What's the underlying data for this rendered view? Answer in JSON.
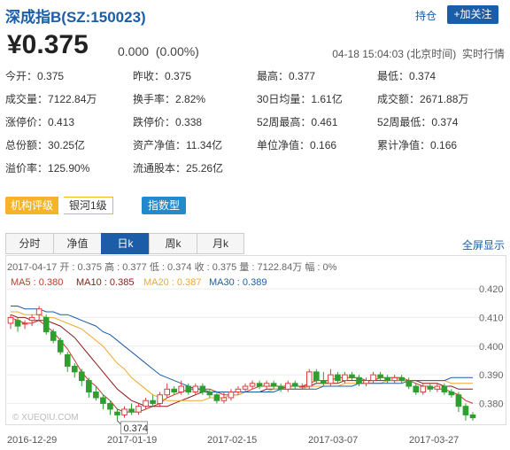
{
  "header": {
    "title": "深成指B(SZ:150023)",
    "hold_label": "持仓",
    "follow_label": "+加关注"
  },
  "quote": {
    "price": "¥0.375",
    "change": "0.000",
    "change_pct": "(0.00%)",
    "time": "04-18 15:04:03 (北京时间)",
    "status": "实时行情"
  },
  "stats": [
    [
      {
        "label": "今开",
        "value": "0.375"
      },
      {
        "label": "昨收",
        "value": "0.375"
      },
      {
        "label": "最高",
        "value": "0.377"
      },
      {
        "label": "最低",
        "value": "0.374"
      }
    ],
    [
      {
        "label": "成交量",
        "value": "7122.84万"
      },
      {
        "label": "换手率",
        "value": "2.82%"
      },
      {
        "label": "30日均量",
        "value": "1.61亿"
      },
      {
        "label": "成交额",
        "value": "2671.88万"
      }
    ],
    [
      {
        "label": "涨停价",
        "value": "0.413"
      },
      {
        "label": "跌停价",
        "value": "0.338"
      },
      {
        "label": "52周最高",
        "value": "0.461"
      },
      {
        "label": "52周最低",
        "value": "0.374"
      }
    ],
    [
      {
        "label": "总份额",
        "value": "30.25亿"
      },
      {
        "label": "资产净值",
        "value": "11.34亿"
      },
      {
        "label": "单位净值",
        "value": "0.166"
      },
      {
        "label": "累计净值",
        "value": "0.166"
      }
    ],
    [
      {
        "label": "溢价率",
        "value": "125.90%"
      },
      {
        "label": "流通股本",
        "value": "25.26亿"
      }
    ]
  ],
  "tags": {
    "rating_label": "机构评级",
    "rating_value": "银河1级",
    "index_label": "指数型"
  },
  "tabs": [
    "分时",
    "净值",
    "日k",
    "周k",
    "月k"
  ],
  "active_tab": "日k",
  "fullscreen_label": "全屏显示",
  "chart_info": "2017-04-17 开 : 0.375 高 : 0.377 低 : 0.374 收 : 0.375 量 : 7122.84万 幅 : 0%",
  "ma_labels": [
    {
      "text": "MA5 : 0.380",
      "color": "#c0392b"
    },
    {
      "text": "MA10 : 0.385",
      "color": "#8b1a1a"
    },
    {
      "text": "MA20 : 0.387",
      "color": "#f0a830"
    },
    {
      "text": "MA30 : 0.389",
      "color": "#1c5da8"
    }
  ],
  "watermark": "© XUEQIU.COM",
  "colors": {
    "up": "#e03c3c",
    "down": "#2e9e2e",
    "accent": "#1c5da8"
  },
  "chart_data": {
    "type": "candlestick",
    "y_ticks": [
      "0.420",
      "0.410",
      "0.400",
      "0.390",
      "0.380"
    ],
    "ylim": [
      0.3755,
      0.4225
    ],
    "x_labels": [
      "2016-12-29",
      "2017-01-19",
      "2017-02-15",
      "2017-03-07",
      "2017-03-27"
    ],
    "low_annotation": "0.374",
    "candles": [
      [
        0.408,
        0.41,
        0.406,
        0.411
      ],
      [
        0.409,
        0.407,
        0.405,
        0.41
      ],
      [
        0.408,
        0.408,
        0.406,
        0.409
      ],
      [
        0.409,
        0.41,
        0.407,
        0.411
      ],
      [
        0.411,
        0.413,
        0.409,
        0.414
      ],
      [
        0.41,
        0.405,
        0.404,
        0.411
      ],
      [
        0.405,
        0.402,
        0.401,
        0.406
      ],
      [
        0.402,
        0.398,
        0.397,
        0.403
      ],
      [
        0.397,
        0.393,
        0.391,
        0.398
      ],
      [
        0.393,
        0.391,
        0.389,
        0.394
      ],
      [
        0.391,
        0.388,
        0.386,
        0.392
      ],
      [
        0.388,
        0.384,
        0.382,
        0.389
      ],
      [
        0.384,
        0.382,
        0.381,
        0.386
      ],
      [
        0.382,
        0.38,
        0.378,
        0.383
      ],
      [
        0.38,
        0.378,
        0.376,
        0.381
      ],
      [
        0.377,
        0.376,
        0.374,
        0.378
      ],
      [
        0.376,
        0.378,
        0.375,
        0.379
      ],
      [
        0.378,
        0.377,
        0.376,
        0.38
      ],
      [
        0.377,
        0.379,
        0.376,
        0.38
      ],
      [
        0.379,
        0.381,
        0.378,
        0.382
      ],
      [
        0.381,
        0.38,
        0.379,
        0.383
      ],
      [
        0.38,
        0.383,
        0.379,
        0.384
      ],
      [
        0.383,
        0.385,
        0.382,
        0.387
      ],
      [
        0.385,
        0.384,
        0.383,
        0.386
      ],
      [
        0.384,
        0.386,
        0.383,
        0.388
      ],
      [
        0.386,
        0.384,
        0.383,
        0.387
      ],
      [
        0.384,
        0.386,
        0.383,
        0.387
      ],
      [
        0.386,
        0.384,
        0.383,
        0.387
      ],
      [
        0.384,
        0.383,
        0.382,
        0.385
      ],
      [
        0.383,
        0.381,
        0.38,
        0.384
      ],
      [
        0.381,
        0.382,
        0.38,
        0.384
      ],
      [
        0.382,
        0.384,
        0.381,
        0.385
      ],
      [
        0.384,
        0.385,
        0.383,
        0.386
      ],
      [
        0.385,
        0.386,
        0.384,
        0.387
      ],
      [
        0.386,
        0.387,
        0.385,
        0.388
      ],
      [
        0.387,
        0.386,
        0.385,
        0.388
      ],
      [
        0.386,
        0.387,
        0.385,
        0.388
      ],
      [
        0.387,
        0.386,
        0.385,
        0.388
      ],
      [
        0.386,
        0.385,
        0.384,
        0.387
      ],
      [
        0.385,
        0.387,
        0.384,
        0.388
      ],
      [
        0.387,
        0.386,
        0.385,
        0.388
      ],
      [
        0.386,
        0.386,
        0.385,
        0.387
      ],
      [
        0.386,
        0.391,
        0.385,
        0.392
      ],
      [
        0.391,
        0.388,
        0.387,
        0.392
      ],
      [
        0.388,
        0.387,
        0.386,
        0.391
      ],
      [
        0.387,
        0.39,
        0.386,
        0.392
      ],
      [
        0.39,
        0.388,
        0.387,
        0.391
      ],
      [
        0.388,
        0.39,
        0.387,
        0.391
      ],
      [
        0.39,
        0.389,
        0.388,
        0.391
      ],
      [
        0.389,
        0.387,
        0.386,
        0.39
      ],
      [
        0.387,
        0.388,
        0.386,
        0.389
      ],
      [
        0.388,
        0.39,
        0.387,
        0.391
      ],
      [
        0.39,
        0.389,
        0.388,
        0.391
      ],
      [
        0.389,
        0.388,
        0.387,
        0.39
      ],
      [
        0.388,
        0.389,
        0.387,
        0.39
      ],
      [
        0.389,
        0.388,
        0.387,
        0.39
      ],
      [
        0.388,
        0.386,
        0.385,
        0.389
      ],
      [
        0.386,
        0.384,
        0.383,
        0.387
      ],
      [
        0.384,
        0.386,
        0.383,
        0.387
      ],
      [
        0.386,
        0.385,
        0.384,
        0.387
      ],
      [
        0.385,
        0.386,
        0.384,
        0.387
      ],
      [
        0.386,
        0.384,
        0.383,
        0.387
      ],
      [
        0.384,
        0.383,
        0.382,
        0.385
      ],
      [
        0.383,
        0.379,
        0.377,
        0.384
      ],
      [
        0.379,
        0.376,
        0.374,
        0.38
      ],
      [
        0.376,
        0.375,
        0.374,
        0.377
      ]
    ],
    "ma_series": [
      {
        "name": "MA5",
        "color": "#c0392b",
        "values": [
          0.41,
          0.409,
          0.408,
          0.408,
          0.409,
          0.407,
          0.405,
          0.402,
          0.399,
          0.395,
          0.391,
          0.388,
          0.386,
          0.383,
          0.381,
          0.378,
          0.377,
          0.377,
          0.377,
          0.378,
          0.379,
          0.38,
          0.382,
          0.383,
          0.384,
          0.385,
          0.385,
          0.385,
          0.385,
          0.384,
          0.383,
          0.383,
          0.383,
          0.384,
          0.385,
          0.386,
          0.386,
          0.386,
          0.386,
          0.386,
          0.386,
          0.386,
          0.387,
          0.388,
          0.388,
          0.388,
          0.389,
          0.389,
          0.389,
          0.389,
          0.388,
          0.388,
          0.389,
          0.389,
          0.389,
          0.389,
          0.388,
          0.387,
          0.386,
          0.386,
          0.385,
          0.385,
          0.384,
          0.383,
          0.381,
          0.38
        ]
      },
      {
        "name": "MA10",
        "color": "#8b1a1a",
        "values": [
          0.411,
          0.41,
          0.41,
          0.409,
          0.409,
          0.409,
          0.408,
          0.407,
          0.405,
          0.403,
          0.4,
          0.397,
          0.394,
          0.391,
          0.388,
          0.385,
          0.383,
          0.381,
          0.38,
          0.379,
          0.379,
          0.379,
          0.379,
          0.38,
          0.381,
          0.382,
          0.383,
          0.384,
          0.384,
          0.384,
          0.384,
          0.384,
          0.384,
          0.384,
          0.384,
          0.384,
          0.385,
          0.385,
          0.385,
          0.386,
          0.386,
          0.386,
          0.386,
          0.387,
          0.387,
          0.387,
          0.387,
          0.388,
          0.388,
          0.388,
          0.388,
          0.388,
          0.388,
          0.388,
          0.388,
          0.388,
          0.388,
          0.388,
          0.387,
          0.387,
          0.387,
          0.386,
          0.386,
          0.385,
          0.385,
          0.385
        ]
      },
      {
        "name": "MA20",
        "color": "#f0a830",
        "values": [
          0.412,
          0.412,
          0.411,
          0.411,
          0.411,
          0.41,
          0.41,
          0.409,
          0.408,
          0.407,
          0.406,
          0.404,
          0.402,
          0.4,
          0.397,
          0.394,
          0.392,
          0.389,
          0.387,
          0.385,
          0.383,
          0.382,
          0.381,
          0.381,
          0.381,
          0.381,
          0.381,
          0.381,
          0.382,
          0.382,
          0.382,
          0.383,
          0.383,
          0.384,
          0.384,
          0.384,
          0.384,
          0.385,
          0.385,
          0.385,
          0.385,
          0.385,
          0.386,
          0.386,
          0.386,
          0.386,
          0.386,
          0.387,
          0.387,
          0.387,
          0.387,
          0.387,
          0.387,
          0.388,
          0.388,
          0.388,
          0.388,
          0.388,
          0.388,
          0.388,
          0.388,
          0.388,
          0.387,
          0.387,
          0.387,
          0.387
        ]
      },
      {
        "name": "MA30",
        "color": "#1c5da8",
        "values": [
          0.414,
          0.414,
          0.413,
          0.413,
          0.413,
          0.412,
          0.412,
          0.411,
          0.411,
          0.41,
          0.409,
          0.408,
          0.407,
          0.405,
          0.404,
          0.402,
          0.4,
          0.398,
          0.396,
          0.394,
          0.392,
          0.39,
          0.389,
          0.388,
          0.387,
          0.386,
          0.385,
          0.385,
          0.384,
          0.384,
          0.384,
          0.384,
          0.384,
          0.384,
          0.384,
          0.384,
          0.384,
          0.384,
          0.385,
          0.385,
          0.385,
          0.385,
          0.385,
          0.385,
          0.386,
          0.386,
          0.386,
          0.386,
          0.386,
          0.387,
          0.387,
          0.387,
          0.387,
          0.387,
          0.387,
          0.387,
          0.388,
          0.388,
          0.388,
          0.388,
          0.388,
          0.388,
          0.389,
          0.389,
          0.389,
          0.389
        ]
      }
    ]
  }
}
